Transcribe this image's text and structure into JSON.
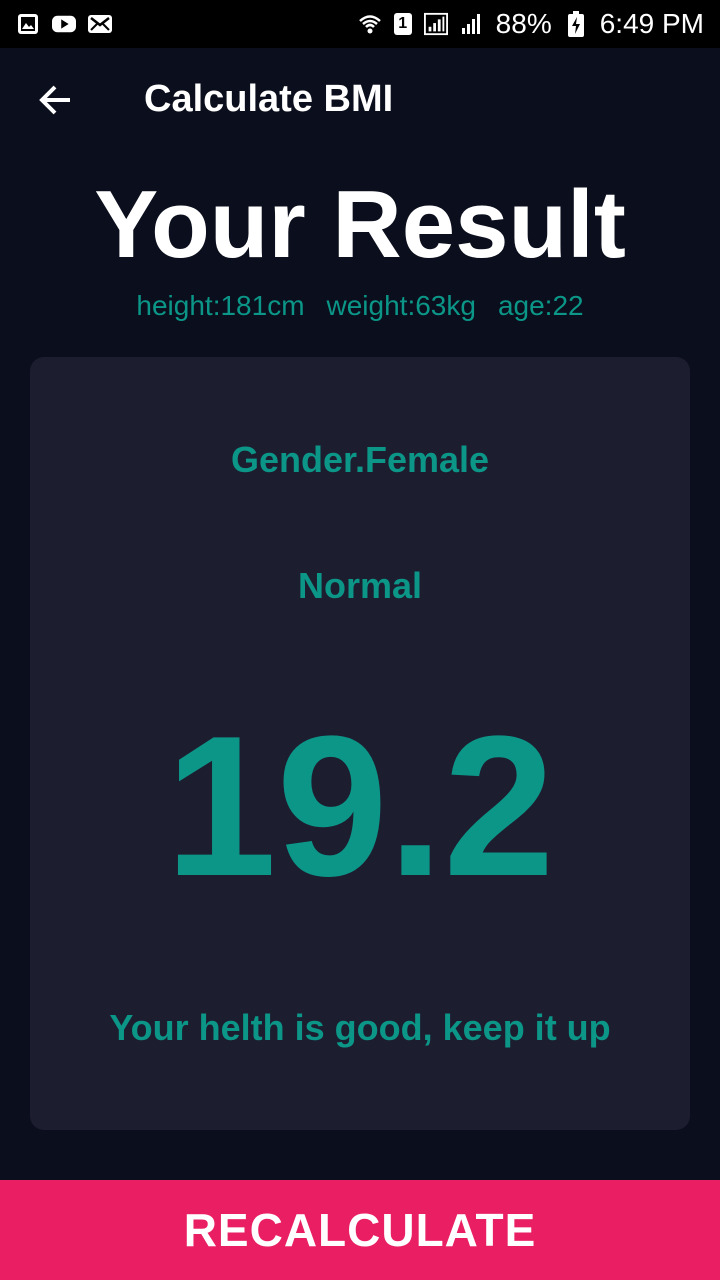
{
  "status_bar": {
    "battery": "88%",
    "time": "6:49 PM",
    "sim_slot": "1",
    "icons": [
      "gallery-icon",
      "youtube-icon",
      "mail-icon",
      "wifi-icon",
      "sim-icon",
      "signal-icon",
      "signal-icon-2",
      "battery-charging-icon"
    ]
  },
  "app_bar": {
    "back_icon": "arrow-back-icon",
    "title": "Calculate BMI"
  },
  "result": {
    "heading": "Your Result",
    "height": "height:181cm",
    "weight": "weight:63kg",
    "age": "age:22"
  },
  "card": {
    "gender": "Gender.Female",
    "category": "Normal",
    "bmi": "19.2",
    "advice": "Your helth is good, keep it up"
  },
  "footer": {
    "button_label": "RECALCULATE"
  },
  "colors": {
    "background": "#0b0e1c",
    "card": "#1d1d30",
    "accent": "#0b9688",
    "button": "#e91e63",
    "text": "#ffffff"
  }
}
